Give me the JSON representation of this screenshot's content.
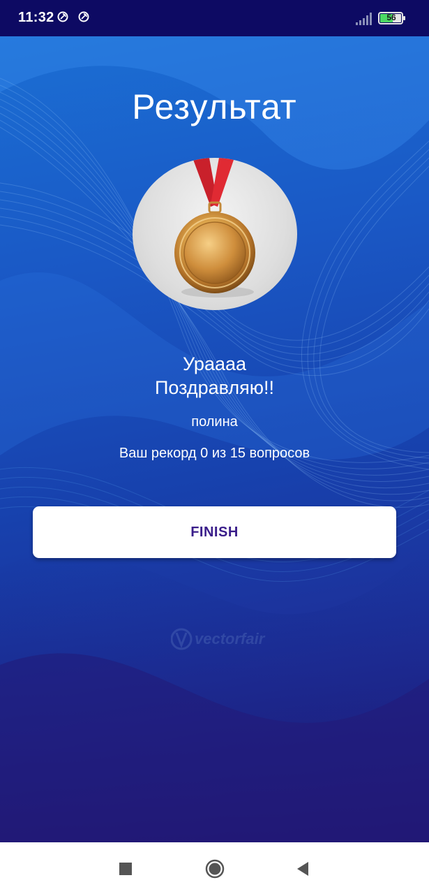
{
  "status_bar": {
    "time": "11:32",
    "battery_level": "56",
    "icons": [
      "notification-icon",
      "notification-icon",
      "signal-icon",
      "battery-icon"
    ]
  },
  "screen": {
    "title": "Результат",
    "congrats_line1": "Ураааа",
    "congrats_line2": "Поздравляю!!",
    "player_name": "полина",
    "record_text": "Ваш рекорд 0 из 15 вопросов",
    "finish_label": "FINISH",
    "watermark": "vectorfair"
  },
  "nav_bar": {
    "buttons": [
      "recents-icon",
      "home-icon",
      "back-icon"
    ]
  },
  "colors": {
    "status_bar": "#0d0a63",
    "background_top": "#1b6fd4",
    "background_bottom": "#24197a",
    "button_text": "#3a1d8a"
  }
}
